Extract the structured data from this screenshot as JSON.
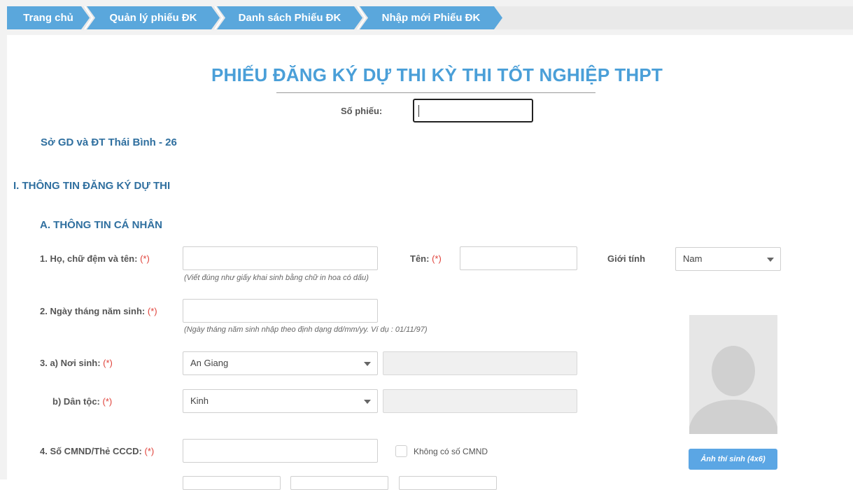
{
  "breadcrumb": {
    "items": [
      "Trang chủ",
      "Quản lý phiếu ĐK",
      "Danh sách Phiếu ĐK",
      "Nhập mới Phiếu ĐK"
    ]
  },
  "form": {
    "title": "PHIẾU ĐĂNG KÝ DỰ THI KỲ THI TỐT NGHIỆP THPT",
    "so_phieu_label": "Số phiếu:",
    "so_phieu_value": "",
    "organization": "Sở GD và ĐT Thái Bình - 26",
    "section_1": "I. THÔNG TIN ĐĂNG KÝ DỰ THI",
    "section_a": "A. THÔNG TIN CÁ NHÂN",
    "required_mark": "(*)"
  },
  "fields": {
    "ho_ten_label": "1. Họ, chữ đệm và tên:",
    "ho_ten_hint": "(Viết đúng như giấy khai sinh bằng chữ in hoa có dấu)",
    "ten_label": "Tên:",
    "gioi_tinh_label": "Giới tính",
    "gioi_tinh_value": "Nam",
    "ngay_sinh_label": "2. Ngày tháng năm sinh:",
    "ngay_sinh_hint": "(Ngày tháng năm sinh nhập theo định dạng dd/mm/yy. Ví dụ : 01/11/97)",
    "noi_sinh_label": "3. a) Nơi sinh:",
    "noi_sinh_value": "An Giang",
    "dan_toc_label": "b) Dân tộc:",
    "dan_toc_value": "Kinh",
    "cmnd_label": "4. Số CMND/Thẻ CCCD:",
    "khong_cmnd_label": "Không có số CMND"
  },
  "photo": {
    "button_label": "Ảnh thí sinh (4x6)"
  },
  "colors": {
    "breadcrumb": "#5aa7dc",
    "title": "#4a9fd8",
    "section": "#2f6f9f",
    "required": "#e0423a",
    "photo_button": "#5ba6e4"
  }
}
